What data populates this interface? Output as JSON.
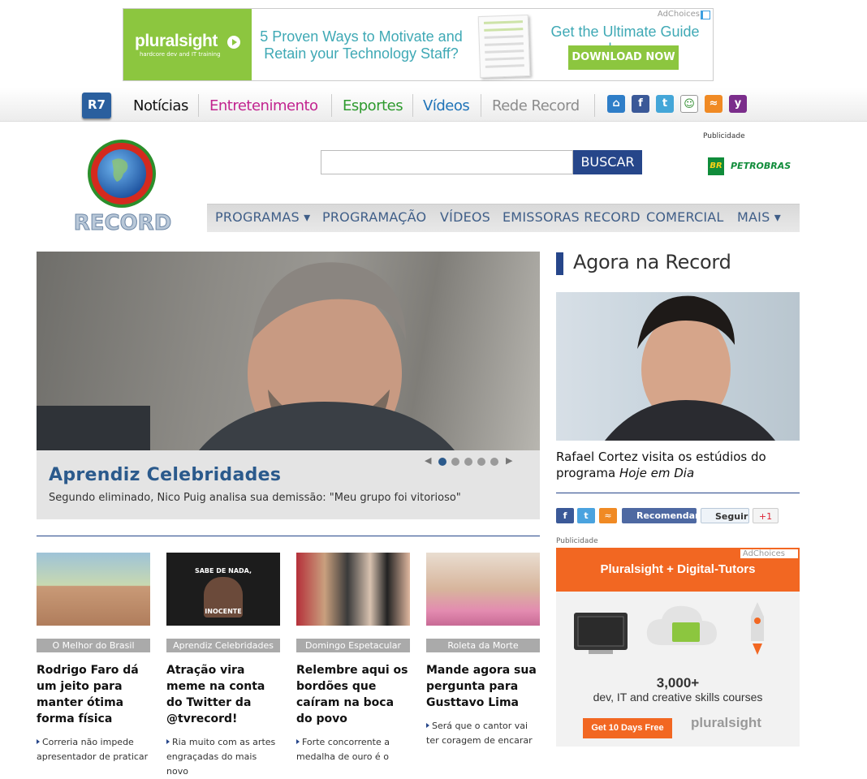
{
  "top_ad": {
    "brand": "pluralsight",
    "tagline": "hardcore dev and IT training",
    "headline": "5 Proven Ways to Motivate and Retain your Technology Staff?",
    "guide": "Get the Ultimate Guide here.",
    "cta": "DOWNLOAD NOW",
    "adchoices": "AdChoices"
  },
  "r7": {
    "logo": "R7",
    "nav": [
      {
        "label": "Notícias",
        "color": "#111111"
      },
      {
        "label": "Entretenimento",
        "color": "#c2248f"
      },
      {
        "label": "Esportes",
        "color": "#2e9a2e"
      },
      {
        "label": "Vídeos",
        "color": "#1f73b8"
      },
      {
        "label": "Rede Record",
        "color": "#8c8c8c"
      }
    ],
    "icons": [
      "home-icon",
      "facebook-icon",
      "twitter-icon",
      "mobile-icon",
      "rss-icon",
      "yahoo-icon"
    ]
  },
  "header": {
    "logo_text": "RECORD",
    "search_placeholder": "",
    "search_button": "BUSCAR",
    "publicidade": "Publicidade",
    "petrobras": "PETROBRAS",
    "petrobras_mark": "BR",
    "nav": [
      "PROGRAMAS ▾",
      "PROGRAMAÇÃO",
      "VÍDEOS",
      "EMISSORAS RECORD",
      "COMERCIAL",
      "MAIS ▾"
    ]
  },
  "hero": {
    "title": "Aprendiz Celebridades",
    "subtitle": "Segundo eliminado, Nico Puig analisa sua demissão: \"Meu grupo foi vitorioso\"",
    "slides": 5,
    "active_slide": 1,
    "prev": "◀",
    "next": "▶"
  },
  "cards": [
    {
      "category": "O Melhor do Brasil",
      "title": "Rodrigo Faro dá um jeito para manter ótima forma física",
      "summary": "Correria não impede apresentador de praticar"
    },
    {
      "category": "Aprendiz Celebridades",
      "title": "Atração vira meme na conta do Twitter da @tvrecord!",
      "summary": "Ria muito com as artes engraçadas do mais novo",
      "meme_top": "SABE DE NADA,",
      "meme_bottom": "INOCENTE"
    },
    {
      "category": "Domingo Espetacular",
      "title": "Relembre aqui os bordões que caíram na boca do povo",
      "summary": "Forte concorrente a medalha de ouro é o"
    },
    {
      "category": "Roleta da Morte",
      "title": "Mande agora sua pergunta para Gusttavo Lima",
      "summary": "Será que o cantor vai ter coragem de encarar"
    }
  ],
  "agora": {
    "title": "Agora na Record",
    "caption_plain": "Rafael Cortez visita os estúdios do programa ",
    "caption_italic": "Hoje em Dia"
  },
  "share": {
    "recomendar": "Recomendar",
    "seguir": "Seguir",
    "gplus": "+1"
  },
  "side_ad": {
    "publicidade": "Publicidade",
    "adchoices": "AdChoices",
    "headline": "Pluralsight + Digital-Tutors",
    "big": "3,000+",
    "small": "dev, IT and creative skills courses",
    "cta": "Get 10 Days Free",
    "brand": "pluralsight"
  }
}
